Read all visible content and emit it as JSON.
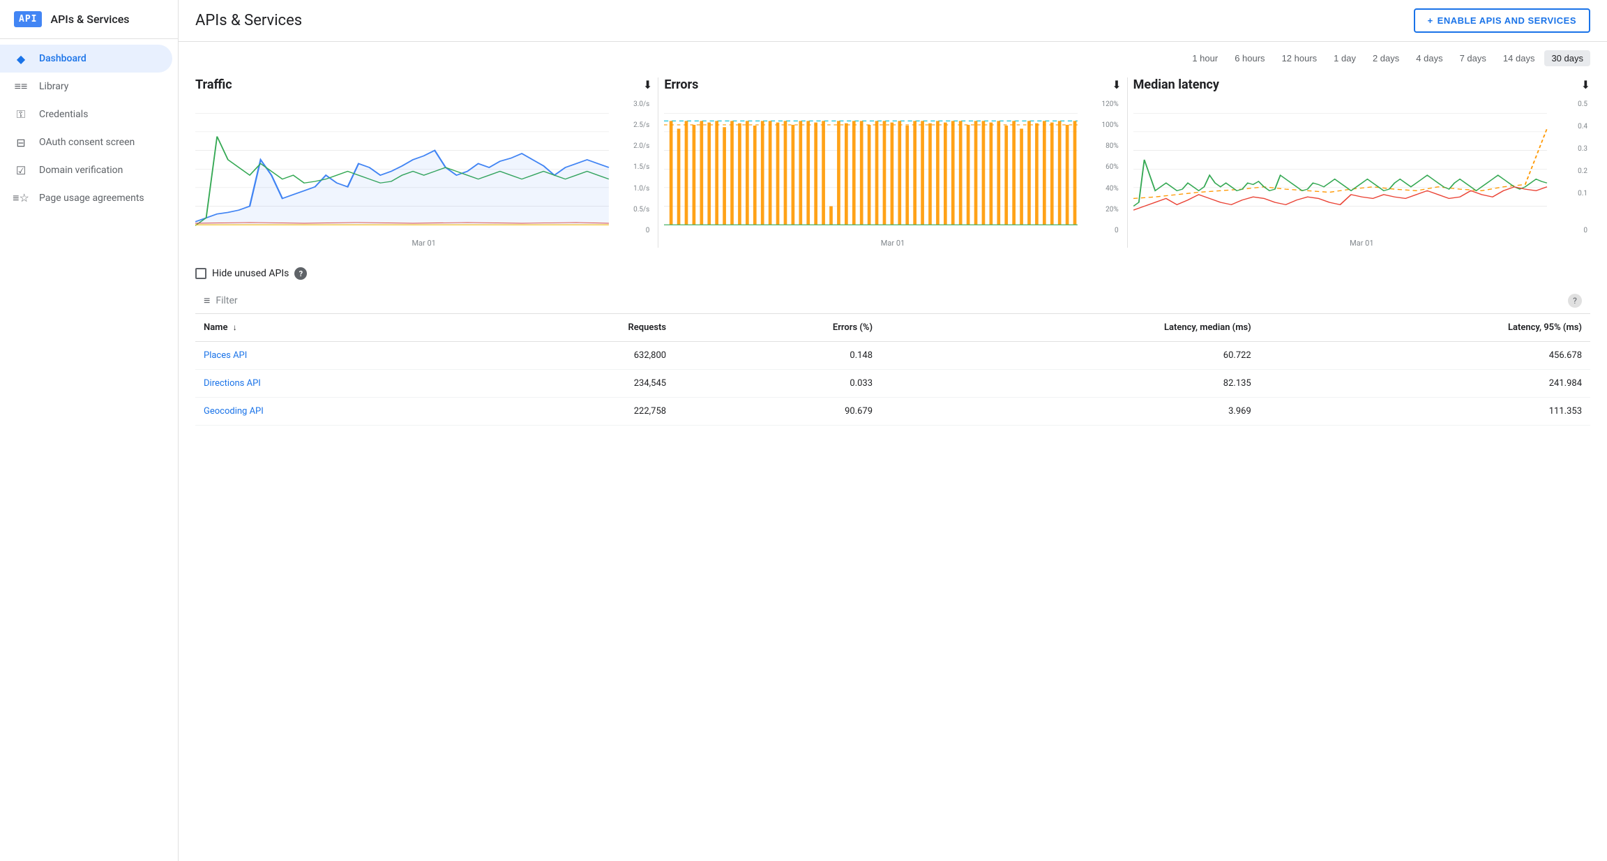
{
  "sidebar": {
    "logo": "API",
    "title": "APIs & Services",
    "nav_items": [
      {
        "id": "dashboard",
        "label": "Dashboard",
        "icon": "◆",
        "active": true
      },
      {
        "id": "library",
        "label": "Library",
        "icon": "≡≡",
        "active": false
      },
      {
        "id": "credentials",
        "label": "Credentials",
        "icon": "⚿",
        "active": false
      },
      {
        "id": "oauth",
        "label": "OAuth consent screen",
        "icon": "⊟",
        "active": false
      },
      {
        "id": "domain",
        "label": "Domain verification",
        "icon": "☑",
        "active": false
      },
      {
        "id": "page_usage",
        "label": "Page usage agreements",
        "icon": "≡☆",
        "active": false
      }
    ]
  },
  "header": {
    "title": "APIs & Services",
    "enable_btn": "ENABLE APIS AND SERVICES",
    "enable_icon": "+"
  },
  "time_ranges": {
    "options": [
      "1 hour",
      "6 hours",
      "12 hours",
      "1 day",
      "2 days",
      "4 days",
      "7 days",
      "14 days",
      "30 days"
    ],
    "active": "30 days"
  },
  "charts": {
    "traffic": {
      "title": "Traffic",
      "x_label": "Mar 01",
      "y_labels": [
        "3.0/s",
        "2.5/s",
        "2.0/s",
        "1.5/s",
        "1.0/s",
        "0.5/s",
        "0"
      ]
    },
    "errors": {
      "title": "Errors",
      "x_label": "Mar 01",
      "y_labels": [
        "120%",
        "100%",
        "80%",
        "60%",
        "40%",
        "20%",
        "0"
      ]
    },
    "latency": {
      "title": "Median latency",
      "x_label": "Mar 01",
      "y_labels": [
        "0.5",
        "0.4",
        "0.3",
        "0.2",
        "0.1",
        "0"
      ]
    }
  },
  "filter": {
    "hide_unused_label": "Hide unused APIs",
    "filter_placeholder": "Filter"
  },
  "table": {
    "columns": [
      "Name",
      "Requests",
      "Errors (%)",
      "Latency, median (ms)",
      "Latency, 95% (ms)"
    ],
    "rows": [
      {
        "name": "Places API",
        "requests": "632,800",
        "errors": "0.148",
        "latency_median": "60.722",
        "latency_95": "456.678"
      },
      {
        "name": "Directions API",
        "requests": "234,545",
        "errors": "0.033",
        "latency_median": "82.135",
        "latency_95": "241.984"
      },
      {
        "name": "Geocoding API",
        "requests": "222,758",
        "errors": "90.679",
        "latency_median": "3.969",
        "latency_95": "111.353"
      }
    ]
  }
}
